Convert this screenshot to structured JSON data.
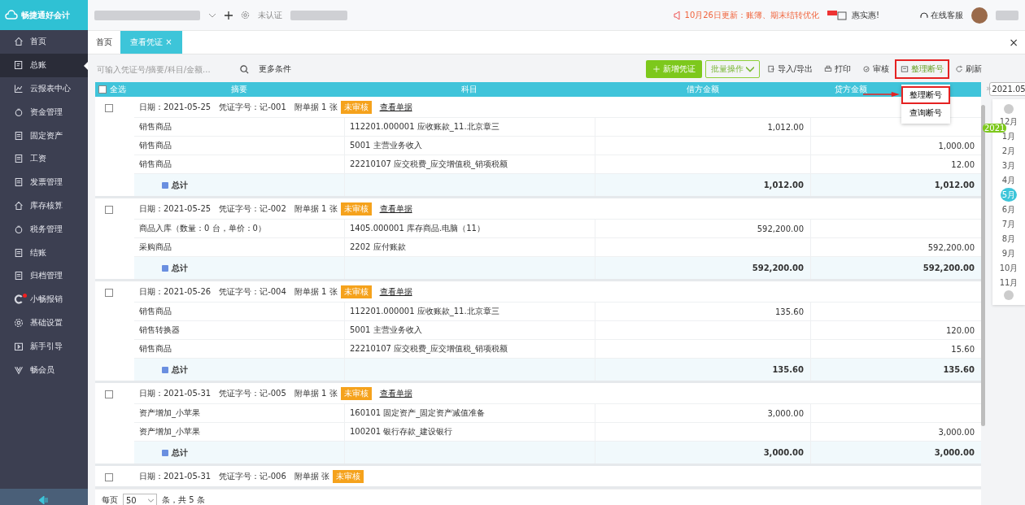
{
  "brand": {
    "name": "畅捷通好会计"
  },
  "sidebar": {
    "items": [
      {
        "label": "首页",
        "selected": false,
        "dot": false
      },
      {
        "label": "总账",
        "selected": true,
        "dot": false
      },
      {
        "label": "云报表中心",
        "selected": false,
        "dot": false
      },
      {
        "label": "资金管理",
        "selected": false,
        "dot": false
      },
      {
        "label": "固定资产",
        "selected": false,
        "dot": false
      },
      {
        "label": "工资",
        "selected": false,
        "dot": false
      },
      {
        "label": "发票管理",
        "selected": false,
        "dot": false
      },
      {
        "label": "库存核算",
        "selected": false,
        "dot": false
      },
      {
        "label": "税务管理",
        "selected": false,
        "dot": false
      },
      {
        "label": "结账",
        "selected": false,
        "dot": false
      },
      {
        "label": "归档管理",
        "selected": false,
        "dot": false
      },
      {
        "label": "小畅报销",
        "selected": false,
        "dot": true
      },
      {
        "label": "基础设置",
        "selected": false,
        "dot": false
      },
      {
        "label": "新手引导",
        "selected": false,
        "dot": false
      },
      {
        "label": "畅会员",
        "selected": false,
        "dot": false
      }
    ]
  },
  "topbar": {
    "auth": "未认证",
    "notice": "10月26日更新：账簿、期末结转优化",
    "promo": "惠实惠!",
    "support": "在线客服"
  },
  "tabs": [
    {
      "label": "首页",
      "selected": false,
      "closable": false
    },
    {
      "label": "查看凭证",
      "selected": true,
      "closable": true
    }
  ],
  "close_glyph": "×",
  "toolbar": {
    "search": {
      "placeholder": "可输入凭证号/摘要/科目/金额..."
    },
    "filter": "更多条件",
    "buttons": [
      {
        "label": "新增凭证",
        "kind": "primary",
        "highlighted": false
      },
      {
        "label": "批量操作",
        "kind": "dropdown",
        "highlighted": false
      },
      {
        "label": "导入/导出",
        "kind": "plain",
        "highlighted": false
      },
      {
        "label": "打印",
        "kind": "plain",
        "highlighted": false
      },
      {
        "label": "审核",
        "kind": "plain",
        "highlighted": false
      },
      {
        "label": "整理断号",
        "kind": "plain",
        "highlighted": true
      },
      {
        "label": "刷新",
        "kind": "plain",
        "highlighted": false
      }
    ]
  },
  "dropdown_menu": {
    "items": [
      {
        "label": "整理断号",
        "highlighted": true
      },
      {
        "label": "查询断号",
        "highlighted": false
      }
    ]
  },
  "table": {
    "columns": [
      "全选",
      "摘要",
      "科目",
      "借方金额",
      "贷方金额"
    ],
    "all_selected": false,
    "vouchers": [
      {
        "selected": false,
        "date": "日期：2021-05-25",
        "number": "凭证字号：记-001",
        "attachments": "附单据 1 张",
        "status": "未审核",
        "link": "查看单据",
        "lines": [
          {
            "summary": "销售商品",
            "account": "112201.000001 应收账款_11.北京章三",
            "debit": "1,012.00"
          },
          {
            "summary": "销售商品",
            "account": "5001 主营业务收入",
            "credit": "1,000.00"
          },
          {
            "summary": "销售商品",
            "account": "22210107 应交税费_应交增值税_销项税额",
            "credit": "12.00"
          }
        ],
        "total": {
          "label": "总计",
          "debit": "1,012.00",
          "credit": "1,012.00"
        }
      },
      {
        "selected": false,
        "date": "日期：2021-05-25",
        "number": "凭证字号：记-002",
        "attachments": "附单据 1 张",
        "status": "未审核",
        "link": "查看单据",
        "lines": [
          {
            "summary": "商品入库（数量：0 台，单价：0）",
            "account": "1405.000001 库存商品.电脑（11）",
            "debit": "592,200.00"
          },
          {
            "summary": "采购商品",
            "account": "2202 应付账款",
            "credit": "592,200.00"
          }
        ],
        "total": {
          "label": "总计",
          "debit": "592,200.00",
          "credit": "592,200.00"
        }
      },
      {
        "selected": false,
        "date": "日期：2021-05-26",
        "number": "凭证字号：记-004",
        "attachments": "附单据 1 张",
        "status": "未审核",
        "link": "查看单据",
        "lines": [
          {
            "summary": "销售商品",
            "account": "112201.000001 应收账款_11.北京章三",
            "debit": "135.60"
          },
          {
            "summary": "销售转换器",
            "account": "5001 主营业务收入",
            "credit": "120.00"
          },
          {
            "summary": "销售商品",
            "account": "22210107 应交税费_应交增值税_销项税额",
            "credit": "15.60"
          }
        ],
        "total": {
          "label": "总计",
          "debit": "135.60",
          "credit": "135.60"
        }
      },
      {
        "selected": false,
        "date": "日期：2021-05-31",
        "number": "凭证字号：记-005",
        "attachments": "附单据 1 张",
        "status": "未审核",
        "link": "查看单据",
        "lines": [
          {
            "summary": "资产增加_小苹果",
            "account": "160101 固定资产_固定资产减值准备",
            "debit": "3,000.00"
          },
          {
            "summary": "资产增加_小苹果",
            "account": "100201 银行存款_建设银行",
            "credit": "3,000.00"
          }
        ],
        "total": {
          "label": "总计",
          "debit": "3,000.00",
          "credit": "3,000.00"
        }
      },
      {
        "selected": false,
        "date": "日期：2021-05-31",
        "number": "凭证字号：记-006",
        "attachments": "附单据 张",
        "status": "未审核"
      }
    ]
  },
  "pagination": {
    "label": "每页",
    "page_size": "50",
    "summary": "条，共 5 条"
  },
  "calendar": {
    "expand_glyph": "»",
    "period": "2021.05",
    "year": "2021",
    "months": [
      {
        "label": "12月",
        "selected": false
      },
      {
        "label": "1月",
        "selected": false
      },
      {
        "label": "2月",
        "selected": false
      },
      {
        "label": "3月",
        "selected": false
      },
      {
        "label": "4月",
        "selected": false
      },
      {
        "label": "5月",
        "selected": true
      },
      {
        "label": "6月",
        "selected": false
      },
      {
        "label": "7月",
        "selected": false
      },
      {
        "label": "8月",
        "selected": false
      },
      {
        "label": "9月",
        "selected": false
      },
      {
        "label": "10月",
        "selected": false
      },
      {
        "label": "11月",
        "selected": false
      }
    ]
  }
}
